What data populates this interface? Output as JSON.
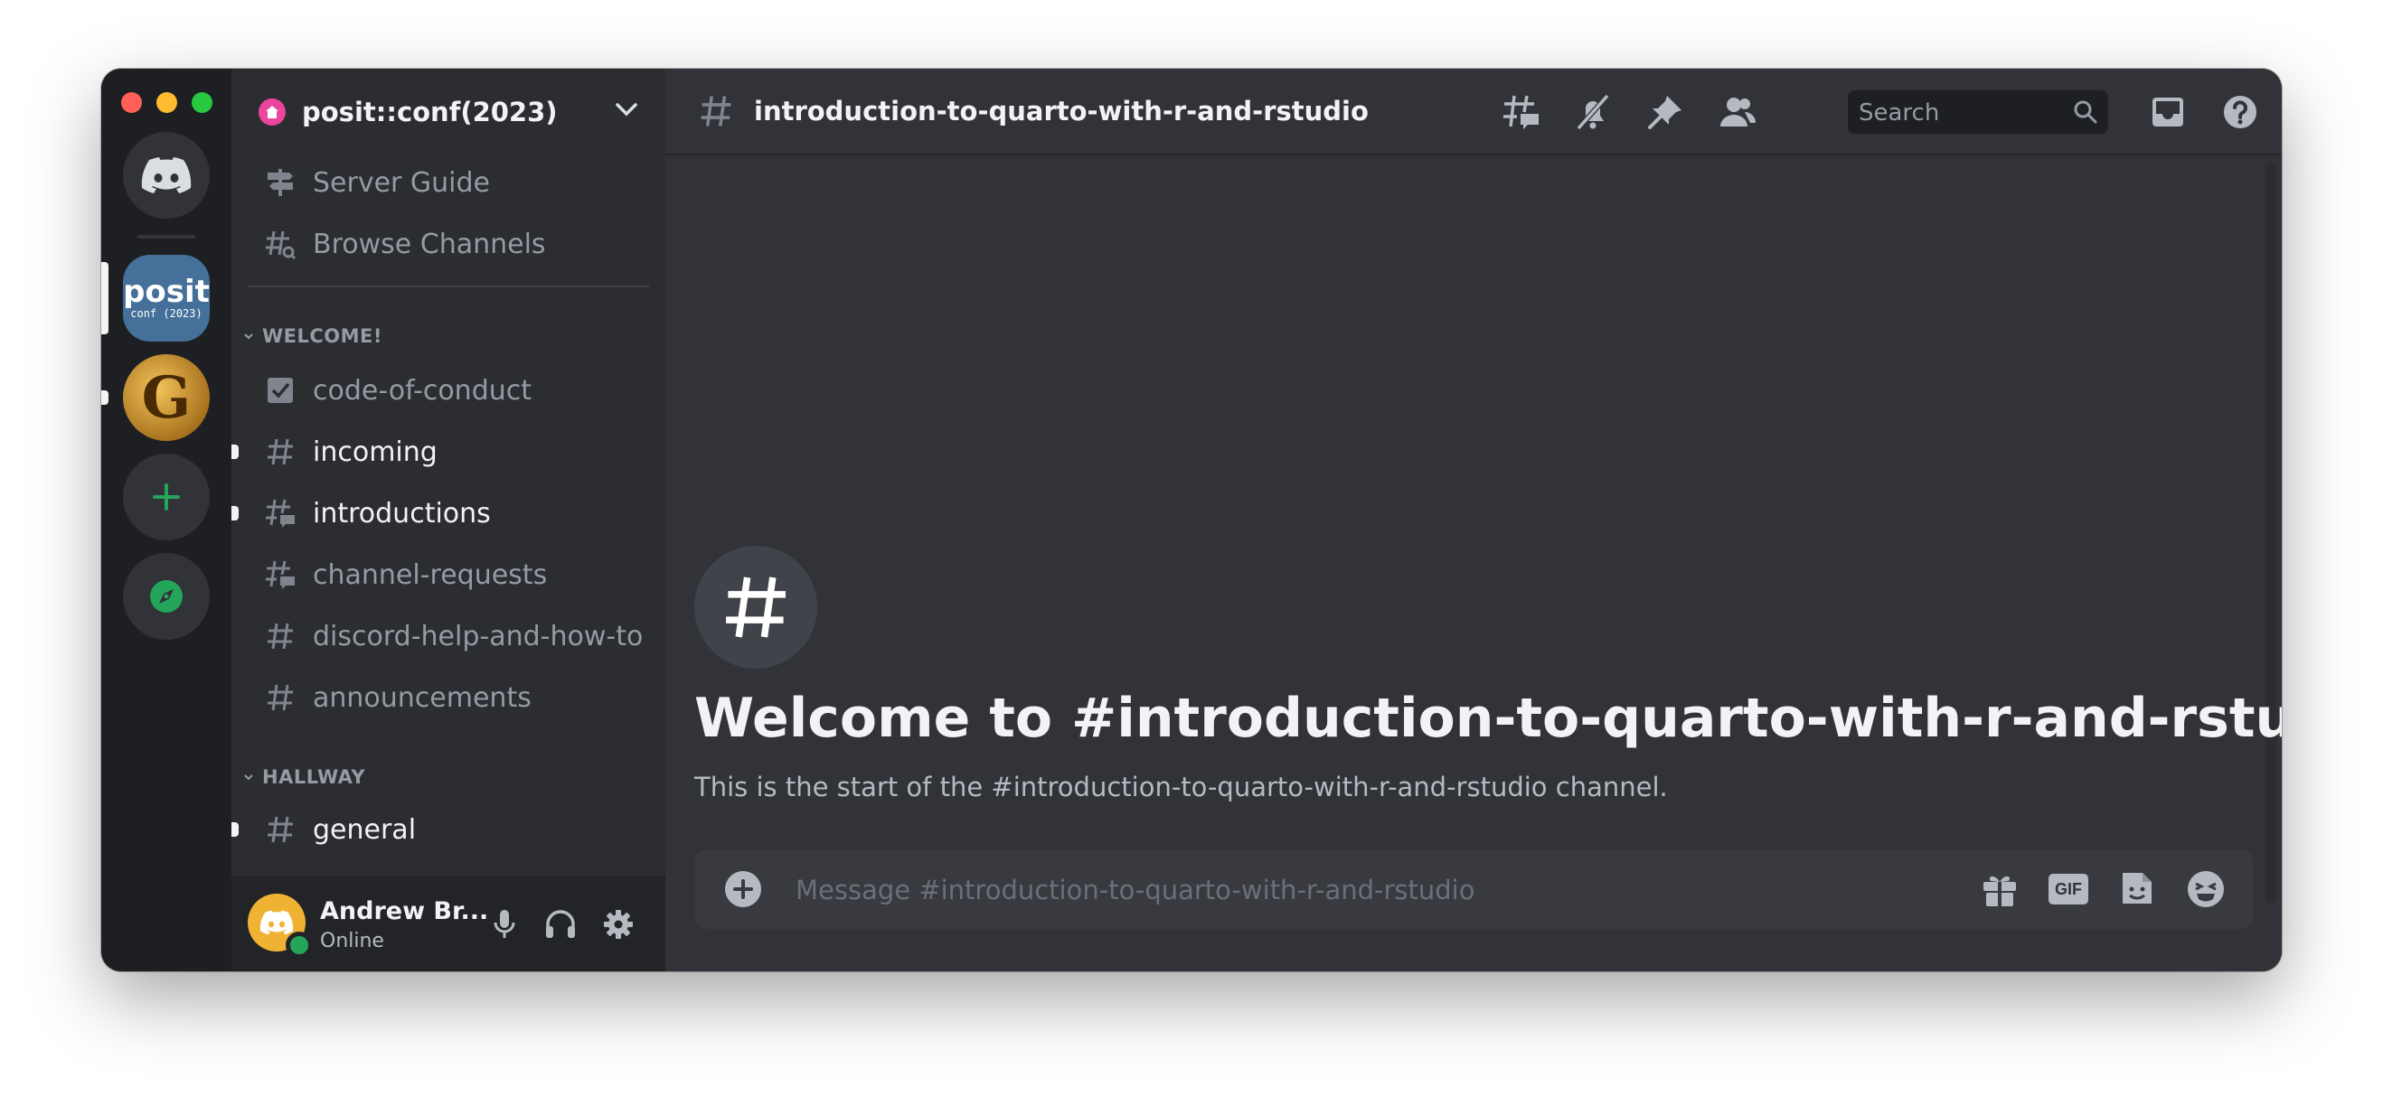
{
  "server": {
    "name": "posit::conf(2023)"
  },
  "rail": {
    "posit_icon_line1": "posit",
    "posit_icon_line2": "conf (2023)",
    "g_icon_letter": "G"
  },
  "sidebar": {
    "top_items": [
      {
        "label": "Server Guide",
        "icon": "signpost-icon"
      },
      {
        "label": "Browse Channels",
        "icon": "browse-channels-icon"
      }
    ],
    "categories": [
      {
        "name": "WELCOME!",
        "channels": [
          {
            "label": "code-of-conduct",
            "icon": "rules-icon",
            "unread": false
          },
          {
            "label": "incoming",
            "icon": "hash-icon",
            "unread": true
          },
          {
            "label": "introductions",
            "icon": "forum-icon",
            "unread": true
          },
          {
            "label": "channel-requests",
            "icon": "forum-icon",
            "unread": false
          },
          {
            "label": "discord-help-and-how-to",
            "icon": "hash-icon",
            "unread": false
          },
          {
            "label": "announcements",
            "icon": "hash-icon",
            "unread": false
          }
        ]
      },
      {
        "name": "HALLWAY",
        "channels": [
          {
            "label": "general",
            "icon": "hash-icon",
            "unread": true
          }
        ]
      }
    ]
  },
  "user": {
    "name": "Andrew Br...",
    "status": "Online"
  },
  "header": {
    "channel_name": "introduction-to-quarto-with-r-and-rstudio",
    "search_placeholder": "Search"
  },
  "welcome": {
    "title": "Welcome to #introduction-to-quarto-with-r-and-rstudio!",
    "subtitle": "This is the start of the #introduction-to-quarto-with-r-and-rstudio channel."
  },
  "composer": {
    "placeholder": "Message #introduction-to-quarto-with-r-and-rstudio",
    "gif_label": "GIF"
  },
  "colors": {
    "rail_bg": "#1e1f22",
    "sidebar_bg": "#2b2d31",
    "main_bg": "#313338",
    "online": "#23a55a",
    "brand": "#5865f2"
  }
}
